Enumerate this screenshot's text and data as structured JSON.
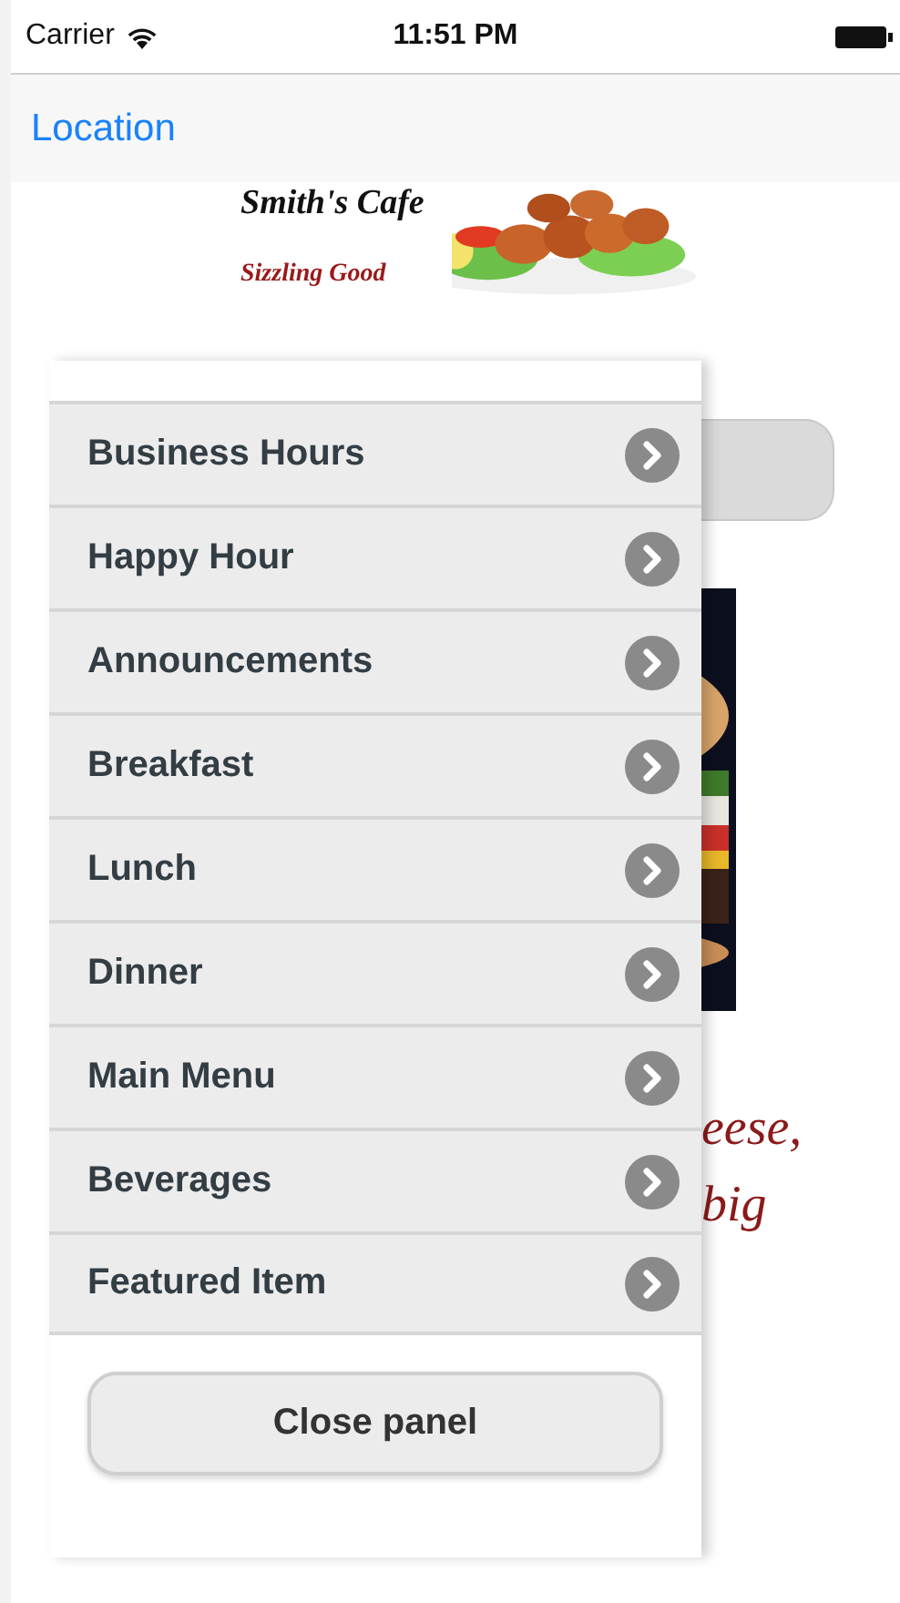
{
  "status_bar": {
    "carrier": "Carrier",
    "time": "11:51 PM"
  },
  "nav_bar": {
    "back_label": "Location"
  },
  "logo": {
    "title": "Smith's Cafe",
    "tagline": "Sizzling Good"
  },
  "background_content": {
    "text_lines": [
      "eese,",
      "big"
    ]
  },
  "panel": {
    "items": [
      {
        "label": "Business Hours"
      },
      {
        "label": "Happy Hour"
      },
      {
        "label": "Announcements"
      },
      {
        "label": "Breakfast"
      },
      {
        "label": "Lunch"
      },
      {
        "label": "Dinner"
      },
      {
        "label": "Main Menu"
      },
      {
        "label": "Beverages"
      },
      {
        "label": "Featured Item"
      }
    ],
    "close_button": "Close panel"
  }
}
